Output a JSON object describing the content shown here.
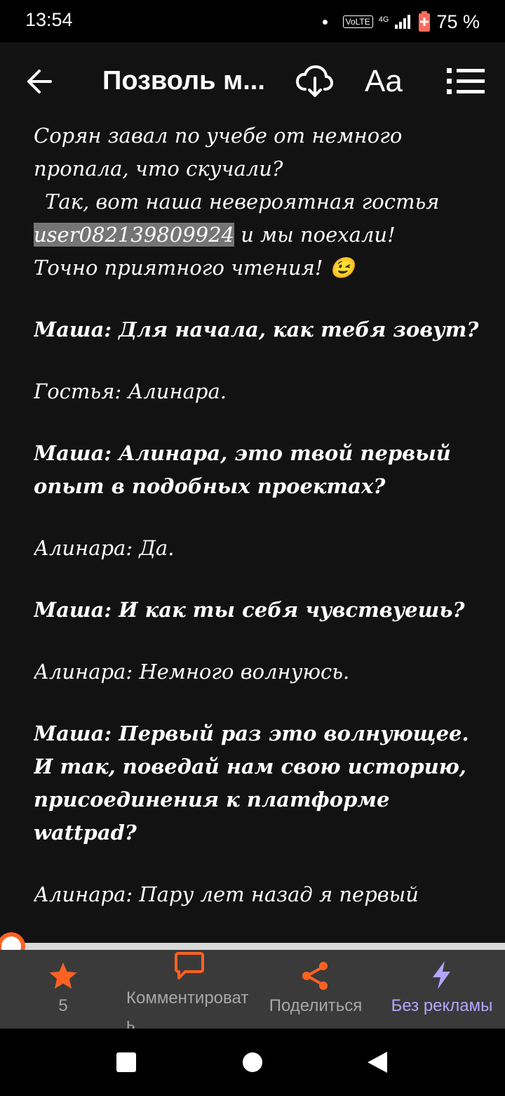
{
  "status": {
    "time": "13:54",
    "volte": "VoLTE",
    "network": "4G",
    "battery": "75 %"
  },
  "toolbar": {
    "title": "Позволь м...",
    "font_label": "Aa"
  },
  "story": {
    "intro_line1": "Сорян завал по учебе от немного пропала, что скучали?",
    "intro_line2": "Так, вот наша невероятная гостья",
    "mention": "user082139809924",
    "intro_line3": " и мы поехали!",
    "intro_line4": "Точно приятного чтения! 😉",
    "q1": "Маша: Для начала, как тебя зовут?",
    "a1": "Гостья: Алинара.",
    "q2": "Маша: Алинара, это твой первый опыт в подобных проектах?",
    "a2": "Алинара: Да.",
    "q3": "Маша: И как ты себя чувствуешь?",
    "a3": "Алинара: Немного волнуюсь.",
    "q4": "Маша: Первый раз это волнующее. И так, поведай нам свою историю, присоединения к платформе wattpad?",
    "a4": "Алинара: Пару лет назад я первый"
  },
  "progress": {
    "value_percent": 0
  },
  "bottom_bar": {
    "vote_count": "5",
    "comment_label": "Комментировать",
    "share_label": "Поделиться",
    "noads_label": "Без рекламы"
  },
  "colors": {
    "accent_orange": "#ff6122",
    "accent_purple": "#b3a6ff",
    "background": "#121212",
    "bottom_bar": "#3a3a3a",
    "highlight": "#757575"
  }
}
